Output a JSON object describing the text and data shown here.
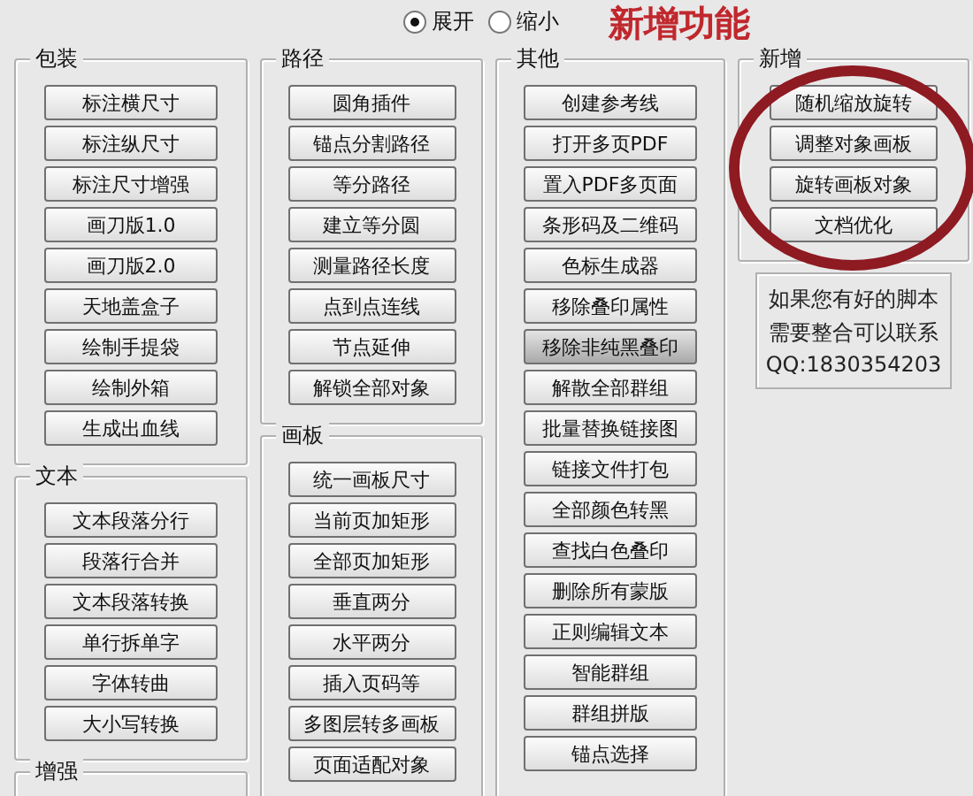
{
  "view_mode": [
    {
      "label": "展开",
      "selected": true
    },
    {
      "label": "缩小",
      "selected": false
    }
  ],
  "annotation": {
    "text": "新增功能"
  },
  "columns": [
    {
      "groups": [
        {
          "title": "包装",
          "buttons": [
            {
              "label": "标注横尺寸",
              "hovered": false
            },
            {
              "label": "标注纵尺寸",
              "hovered": false
            },
            {
              "label": "标注尺寸增强",
              "hovered": false
            },
            {
              "label": "画刀版1.0",
              "hovered": false
            },
            {
              "label": "画刀版2.0",
              "hovered": false
            },
            {
              "label": "天地盖盒子",
              "hovered": false
            },
            {
              "label": "绘制手提袋",
              "hovered": false
            },
            {
              "label": "绘制外箱",
              "hovered": false
            },
            {
              "label": "生成出血线",
              "hovered": false
            }
          ]
        },
        {
          "title": "文本",
          "buttons": [
            {
              "label": "文本段落分行",
              "hovered": false
            },
            {
              "label": "段落行合并",
              "hovered": false
            },
            {
              "label": "文本段落转换",
              "hovered": false
            },
            {
              "label": "单行拆单字",
              "hovered": false
            },
            {
              "label": "字体转曲",
              "hovered": false
            },
            {
              "label": "大小写转换",
              "hovered": false
            }
          ]
        },
        {
          "title": "增强"
        }
      ]
    },
    {
      "groups": [
        {
          "title": "路径",
          "buttons": [
            {
              "label": "圆角插件",
              "hovered": false
            },
            {
              "label": "锚点分割路径",
              "hovered": false
            },
            {
              "label": "等分路径",
              "hovered": false
            },
            {
              "label": "建立等分圆",
              "hovered": false
            },
            {
              "label": "测量路径长度",
              "hovered": false
            },
            {
              "label": "点到点连线",
              "hovered": false
            },
            {
              "label": "节点延伸",
              "hovered": false
            },
            {
              "label": "解锁全部对象",
              "hovered": false
            }
          ]
        },
        {
          "title": "画板",
          "buttons": [
            {
              "label": "统一画板尺寸",
              "hovered": false
            },
            {
              "label": "当前页加矩形",
              "hovered": false
            },
            {
              "label": "全部页加矩形",
              "hovered": false
            },
            {
              "label": "垂直两分",
              "hovered": false
            },
            {
              "label": "水平两分",
              "hovered": false
            },
            {
              "label": "插入页码等",
              "hovered": false
            },
            {
              "label": "多图层转多画板",
              "hovered": false
            },
            {
              "label": "页面适配对象",
              "hovered": false
            }
          ]
        }
      ]
    },
    {
      "groups": [
        {
          "title": "其他",
          "buttons": [
            {
              "label": "创建参考线",
              "hovered": false
            },
            {
              "label": "打开多页PDF",
              "hovered": false
            },
            {
              "label": "置入PDF多页面",
              "hovered": false
            },
            {
              "label": "条形码及二维码",
              "hovered": false
            },
            {
              "label": "色标生成器",
              "hovered": false
            },
            {
              "label": "移除叠印属性",
              "hovered": false
            },
            {
              "label": "移除非纯黑叠印",
              "hovered": true
            },
            {
              "label": "解散全部群组",
              "hovered": false
            },
            {
              "label": "批量替换链接图",
              "hovered": false
            },
            {
              "label": "链接文件打包",
              "hovered": false
            },
            {
              "label": "全部颜色转黑",
              "hovered": false
            },
            {
              "label": "查找白色叠印",
              "hovered": false
            },
            {
              "label": "删除所有蒙版",
              "hovered": false
            },
            {
              "label": "正则编辑文本",
              "hovered": false
            },
            {
              "label": "智能群组",
              "hovered": false
            },
            {
              "label": "群组拼版",
              "hovered": false
            },
            {
              "label": "锚点选择",
              "hovered": false
            }
          ]
        }
      ]
    },
    {
      "groups": [
        {
          "title": "新增",
          "buttons": [
            {
              "label": "随机缩放旋转",
              "hovered": false
            },
            {
              "label": "调整对象画板",
              "hovered": false
            },
            {
              "label": "旋转画板对象",
              "hovered": false
            },
            {
              "label": "文档优化",
              "hovered": false
            }
          ]
        }
      ],
      "info": [
        "如果您有好的脚本",
        "需要整合可以联系",
        "QQ:1830354203"
      ]
    }
  ]
}
